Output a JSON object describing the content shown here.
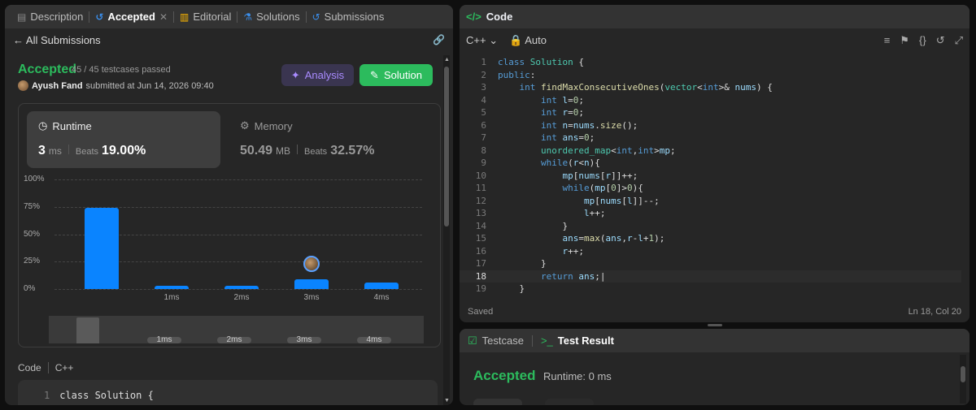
{
  "left_tabs": [
    {
      "label": "Description",
      "icon": "description-icon"
    },
    {
      "label": "Accepted",
      "icon": "history-icon"
    },
    {
      "label": "Editorial",
      "icon": "book-icon"
    },
    {
      "label": "Solutions",
      "icon": "flask-icon"
    },
    {
      "label": "Submissions",
      "icon": "history-icon"
    }
  ],
  "back_link": "All Submissions",
  "status": {
    "label": "Accepted",
    "testcases": "45 / 45 testcases passed",
    "user": "Ayush Fand",
    "submitted": "submitted at Jun 14, 2026 09:40"
  },
  "buttons": {
    "analysis": "Analysis",
    "solution": "Solution"
  },
  "runtime": {
    "title": "Runtime",
    "value": "3",
    "unit": "ms",
    "beats_label": "Beats",
    "beats": "19.00%"
  },
  "memory": {
    "title": "Memory",
    "value": "50.49",
    "unit": "MB",
    "beats_label": "Beats",
    "beats": "32.57%"
  },
  "chart_data": {
    "type": "bar",
    "categories": [
      "",
      "1ms",
      "2ms",
      "3ms",
      "4ms"
    ],
    "values": [
      74,
      3,
      3,
      9,
      6
    ],
    "yticks": [
      "100%",
      "75%",
      "50%",
      "25%",
      "0%"
    ],
    "ylim": [
      0,
      100
    ],
    "highlight": "3ms"
  },
  "minimap_labels": [
    "1ms",
    "2ms",
    "3ms",
    "4ms"
  ],
  "code_section": {
    "label": "Code",
    "lang": "C++",
    "first_line_no": "1",
    "first_line": "class Solution {"
  },
  "editor": {
    "title": "Code",
    "lang": "C++",
    "auto": "Auto",
    "status": "Saved",
    "cursor": "Ln 18, Col 20"
  },
  "result": {
    "tab_testcase": "Testcase",
    "tab_result": "Test Result",
    "status": "Accepted",
    "runtime": "Runtime: 0 ms"
  },
  "colors": {
    "accepted": "#2cbb5d",
    "bar": "#0a84ff",
    "analysis": "#a98bff"
  }
}
